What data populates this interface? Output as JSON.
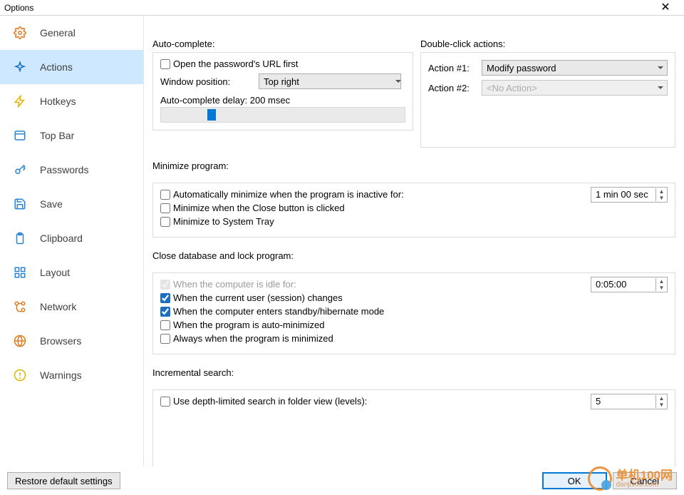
{
  "window": {
    "title": "Options"
  },
  "sidebar": {
    "items": [
      {
        "label": "General"
      },
      {
        "label": "Actions"
      },
      {
        "label": "Hotkeys"
      },
      {
        "label": "Top Bar"
      },
      {
        "label": "Passwords"
      },
      {
        "label": "Save"
      },
      {
        "label": "Clipboard"
      },
      {
        "label": "Layout"
      },
      {
        "label": "Network"
      },
      {
        "label": "Browsers"
      },
      {
        "label": "Warnings"
      }
    ]
  },
  "auto_complete": {
    "title": "Auto-complete:",
    "open_url_label": "Open the password's URL first",
    "window_pos_label": "Window position:",
    "window_pos_value": "Top right",
    "delay_label": "Auto-complete delay: 200 msec"
  },
  "double_click": {
    "title": "Double-click actions:",
    "a1_label": "Action #1:",
    "a1_value": "Modify password",
    "a2_label": "Action #2:",
    "a2_value": "<No Action>"
  },
  "minimize": {
    "title": "Minimize program:",
    "auto_min_label": "Automatically minimize when the program is inactive for:",
    "auto_min_value": "1 min 00 sec",
    "close_btn_label": "Minimize when the Close button is clicked",
    "systray_label": "Minimize to System Tray"
  },
  "close_lock": {
    "title": "Close database and lock program:",
    "idle_label": "When the computer is idle for:",
    "idle_value": "0:05:00",
    "session_label": "When the current user (session) changes",
    "standby_label": "When the computer enters standby/hibernate mode",
    "automin_label": "When the program is auto-minimized",
    "alwaysmin_label": "Always when the program is minimized"
  },
  "search": {
    "title": "Incremental search:",
    "depth_label": "Use depth-limited search in folder view (levels):",
    "depth_value": "5"
  },
  "buttons": {
    "restore": "Restore default settings",
    "ok": "OK",
    "cancel": "Cancel"
  },
  "watermark": {
    "line1": "单机100网",
    "line2": "danji100.com"
  }
}
